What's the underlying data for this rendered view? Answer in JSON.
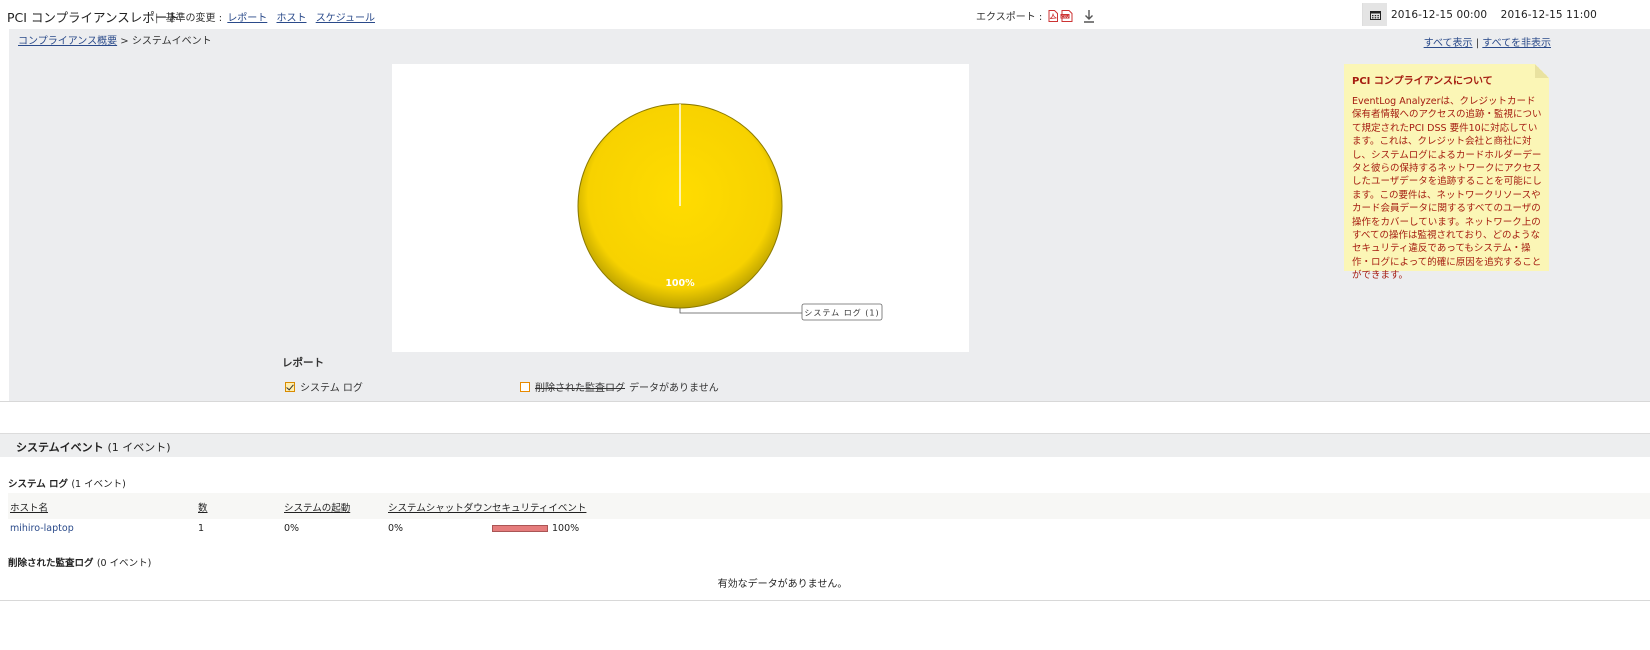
{
  "header": {
    "title": "PCI コンプライアンスレポート",
    "criteria_label": "基準の変更 :",
    "criteria_links": [
      "レポート",
      "ホスト",
      "スケジュール"
    ],
    "export_label": "エクスポート :",
    "date_start": "2016-12-15 00:00",
    "date_end": "2016-12-15 11:00"
  },
  "breadcrumb": {
    "root": "コンプライアンス概要",
    "separator": ">",
    "current": "システムイベント"
  },
  "toggles": {
    "show_all": "すべて表示",
    "divider": "|",
    "hide_all": "すべてを非表示"
  },
  "chart_data": {
    "type": "pie",
    "slices": [
      {
        "label": "システム ログ",
        "value": 1,
        "percent": 100,
        "color": "#ffd600"
      }
    ],
    "data_label": "100%",
    "callout": "システム ログ (1)"
  },
  "reports": {
    "label": "レポート",
    "items": [
      {
        "label": "システム ログ",
        "checked": true,
        "color": "#ffd600"
      },
      {
        "label": "削除された監査ログ",
        "checked": false,
        "suffix": "データがありません",
        "color": "#e88a00"
      }
    ]
  },
  "note": {
    "title": "PCI コンプライアンスについて",
    "body": "EventLog Analyzerは、クレジットカード保有者情報へのアクセスの追跡・監視について規定されたPCI DSS 要件10に対応しています。これは、クレジット会社と商社に対し、システムログによるカードホルダーデータと彼らの保持するネットワークにアクセスしたユーザデータを追跡することを可能にします。この要件は、ネットワークリソースやカード会員データに関するすべてのユーザの操作をカバーしています。ネットワーク上のすべての操作は監視されており、どのようなセキュリティ違反であってもシステム・操作・ログによって的確に原因を追究することができます。"
  },
  "section": {
    "title": "システムイベント",
    "count": "(1 イベント)"
  },
  "syslog": {
    "title": "システム ログ",
    "count": "(1 イベント)",
    "columns": [
      "ホスト名",
      "数",
      "システムの起動",
      "システムシャットダウン",
      "セキュリティイベント"
    ],
    "rows": [
      {
        "host": "mihiro-laptop",
        "count": "1",
        "startup": "0%",
        "shutdown": "0%",
        "security": "100%",
        "security_fraction": 1.0
      }
    ]
  },
  "deleted_audit": {
    "title": "削除された監査ログ",
    "count": "(0 イベント)",
    "empty_message": "有効なデータがありません。"
  },
  "colors": {
    "panel_bg": "#ecedef",
    "note_bg": "#fbf6b6",
    "note_text": "#a51c10",
    "link": "#2a4a8a",
    "pie": "#ffd600",
    "bar": "#e57c7c"
  }
}
